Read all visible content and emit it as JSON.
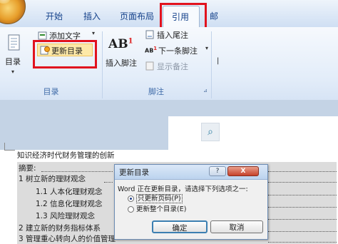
{
  "ribbon": {
    "tabs": [
      "开始",
      "插入",
      "页面布局",
      "引用",
      "邮"
    ],
    "active_tab_index": 3,
    "groups": {
      "toc": {
        "label": "目录",
        "toc_button": "目录",
        "add_text": "添加文字",
        "update_toc": "更新目录"
      },
      "footnotes": {
        "label": "脚注",
        "insert_footnote": "插入脚注",
        "insert_endnote": "插入尾注",
        "next_footnote": "下一条脚注",
        "show_notes": "显示备注",
        "ab_glyph": "AB",
        "ab_sup": "1"
      }
    }
  },
  "document": {
    "title": "知识经济时代财务管理的创新",
    "toc_lines": [
      {
        "text": "摘要:"
      },
      {
        "text": "1 树立新的理财观念"
      },
      {
        "text": "1.1 人本化理财观念"
      },
      {
        "text": "1.2 信息化理财观念"
      },
      {
        "text": "1.3 风险理财观念"
      },
      {
        "text": "2 建立新的财务指标体系"
      },
      {
        "text": "3 管理重心转向人的价值管理"
      }
    ]
  },
  "dialog": {
    "title": "更新目录",
    "message": "Word 正在更新目录，请选择下列选项之一:",
    "options": [
      "只更新页码(P)",
      "更新整个目录(E)"
    ],
    "selected_option": 0,
    "ok": "确定",
    "cancel": "取消",
    "help_glyph": "?",
    "close_glyph": "X"
  },
  "colors": {
    "highlight_red": "#e1121e",
    "ribbon_text": "#15428b"
  }
}
